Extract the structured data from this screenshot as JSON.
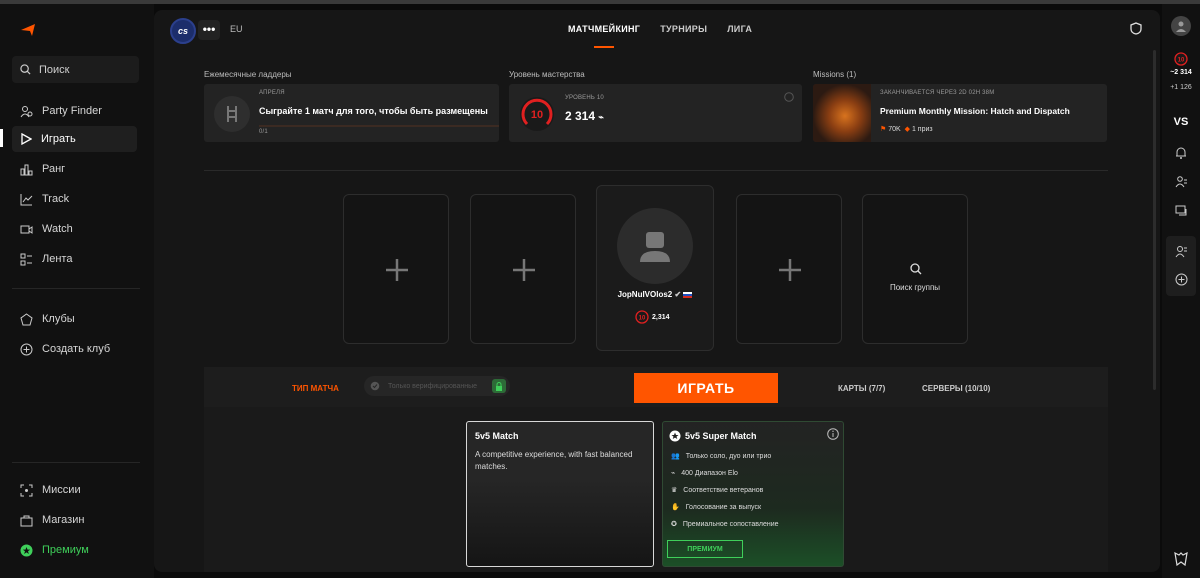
{
  "sidebar": {
    "search_placeholder": "Поиск",
    "items": [
      {
        "label": "Party Finder",
        "icon": "party-finder-icon"
      },
      {
        "label": "Играть",
        "icon": "play-icon"
      },
      {
        "label": "Ранг",
        "icon": "rank-icon"
      },
      {
        "label": "Track",
        "icon": "track-icon"
      },
      {
        "label": "Watch",
        "icon": "watch-icon"
      },
      {
        "label": "Лента",
        "icon": "feed-icon"
      }
    ],
    "clubs": [
      {
        "label": "Клубы",
        "icon": "clubs-icon"
      },
      {
        "label": "Создать клуб",
        "icon": "create-club-icon"
      }
    ],
    "bottom": [
      {
        "label": "Миссии",
        "icon": "missions-icon"
      },
      {
        "label": "Магазин",
        "icon": "shop-icon"
      },
      {
        "label": "Премиум",
        "icon": "premium-icon"
      }
    ]
  },
  "header": {
    "game_badge": "cs",
    "more": "•••",
    "region": "EU",
    "tabs": [
      "МАТЧМЕЙКИНГ",
      "ТУРНИРЫ",
      "ЛИГА"
    ]
  },
  "cards": {
    "ladder": {
      "section": "Ежемесячные ладдеры",
      "caption": "АПРЕЛЯ",
      "title": "Сыграйте 1 матч для того, чтобы быть размещены",
      "progress": "0/1"
    },
    "mastery": {
      "section": "Уровень мастерства",
      "caption": "УРОВЕНЬ 10",
      "level": "10",
      "elo": "2 314"
    },
    "missions": {
      "section": "Missions (1)",
      "caption": "ЗАКАНЧИВАЕТСЯ ЧЕРЕЗ 2D 02H 38M",
      "title": "Premium Monthly Mission: Hatch and Dispatch",
      "reward_points": "70K",
      "reward_prize": "1 приз"
    }
  },
  "party": {
    "player_name": "JopNuIVOlos2",
    "player_level": "10",
    "player_elo": "2,314",
    "find_group": "Поиск группы"
  },
  "match_bar": {
    "match_type": "ТИП МАТЧА",
    "toggle_label": "Только верифицированные",
    "play": "ИГРАТЬ",
    "maps": "КАРТЫ (7/7)",
    "servers": "СЕРВЕРЫ (10/10)"
  },
  "modes": {
    "standard": {
      "title": "5v5 Match",
      "desc": "A competitive experience, with fast balanced matches."
    },
    "super": {
      "title": "5v5 Super Match",
      "features": [
        "Только соло, дуо или трио",
        "400 Диапазон Elo",
        "Соответствие ветеранов",
        "Голосование за выпуск",
        "Премиальное сопоставление"
      ],
      "button": "ПРЕМИУМ"
    }
  },
  "rail": {
    "elo": "~2 314",
    "delta": "+1 126",
    "level": "10",
    "vs": "VS"
  },
  "colors": {
    "accent": "#ff5500",
    "premium": "#3fcf5a"
  }
}
